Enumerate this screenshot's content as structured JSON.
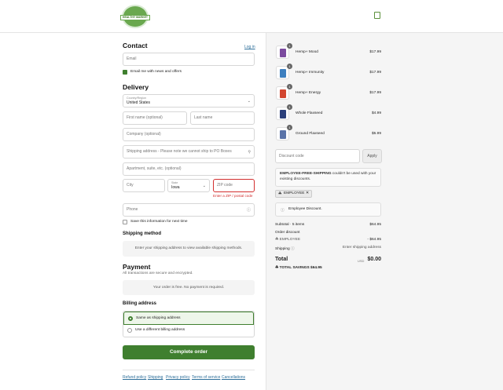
{
  "brand": {
    "logo_text": "HEALTHY MARKET"
  },
  "contact": {
    "heading": "Contact",
    "login_link": "Log in",
    "email_placeholder": "Email",
    "newsletter_label": "Email me with news and offers"
  },
  "delivery": {
    "heading": "Delivery",
    "country_label": "Country/Region",
    "country_value": "United States",
    "first_name_placeholder": "First name (optional)",
    "last_name_placeholder": "Last name",
    "company_placeholder": "Company (optional)",
    "address_placeholder": "Shipping address - Please note we cannot ship to PO Boxes",
    "apartment_placeholder": "Apartment, suite, etc. (optional)",
    "city_placeholder": "City",
    "state_label": "State",
    "state_value": "Iowa",
    "zip_placeholder": "ZIP code",
    "zip_error": "Enter a ZIP / postal code",
    "phone_placeholder": "Phone",
    "save_info_label": "Save this information for next time"
  },
  "shipping_method": {
    "heading": "Shipping method",
    "message": "Enter your shipping address to view available shipping methods."
  },
  "payment": {
    "heading": "Payment",
    "subtext": "All transactions are secure and encrypted.",
    "message": "Your order is free. No payment is required."
  },
  "billing": {
    "heading": "Billing address",
    "option_same": "Same as shipping address",
    "option_different": "Use a different billing address"
  },
  "complete_button": "Complete order",
  "footer_links": [
    "Refund policy",
    "Shipping",
    "Privacy policy",
    "Terms of service",
    "Cancellations"
  ],
  "cart": {
    "items": [
      {
        "name": "Hemp+ Mood",
        "qty": "1",
        "price": "$17.99",
        "color": "#7b4a9e"
      },
      {
        "name": "Hemp+ Immunity",
        "qty": "1",
        "price": "$17.99",
        "color": "#3d7fbf"
      },
      {
        "name": "Hemp+ Energy",
        "qty": "1",
        "price": "$17.99",
        "color": "#d2452f"
      },
      {
        "name": "Whole Flaxseed",
        "qty": "1",
        "price": "$4.99",
        "color": "#2b3f7a"
      },
      {
        "name": "Ground Flaxseed",
        "qty": "1",
        "price": "$5.99",
        "color": "#5a73a8"
      }
    ],
    "discount_placeholder": "Discount code",
    "apply_label": "Apply",
    "notice_code": "EMPLOYEE-FREE-SHIPPING",
    "notice_rest": " couldn't be used with your existing discounts.",
    "tag_label": "EMPLOYEE",
    "info_label": "Employee Discount.",
    "subtotal_label": "Subtotal · 5 items",
    "subtotal_value": "$64.95",
    "order_discount_label": "Order discount",
    "discount_code": "EMPLOYEE",
    "discount_value": "- $64.95",
    "shipping_label": "Shipping",
    "shipping_value": "Enter shipping address",
    "total_label": "Total",
    "currency": "USD",
    "total_value": "$0.00",
    "savings_label": "TOTAL SAVINGS",
    "savings_value": "$64.95"
  }
}
